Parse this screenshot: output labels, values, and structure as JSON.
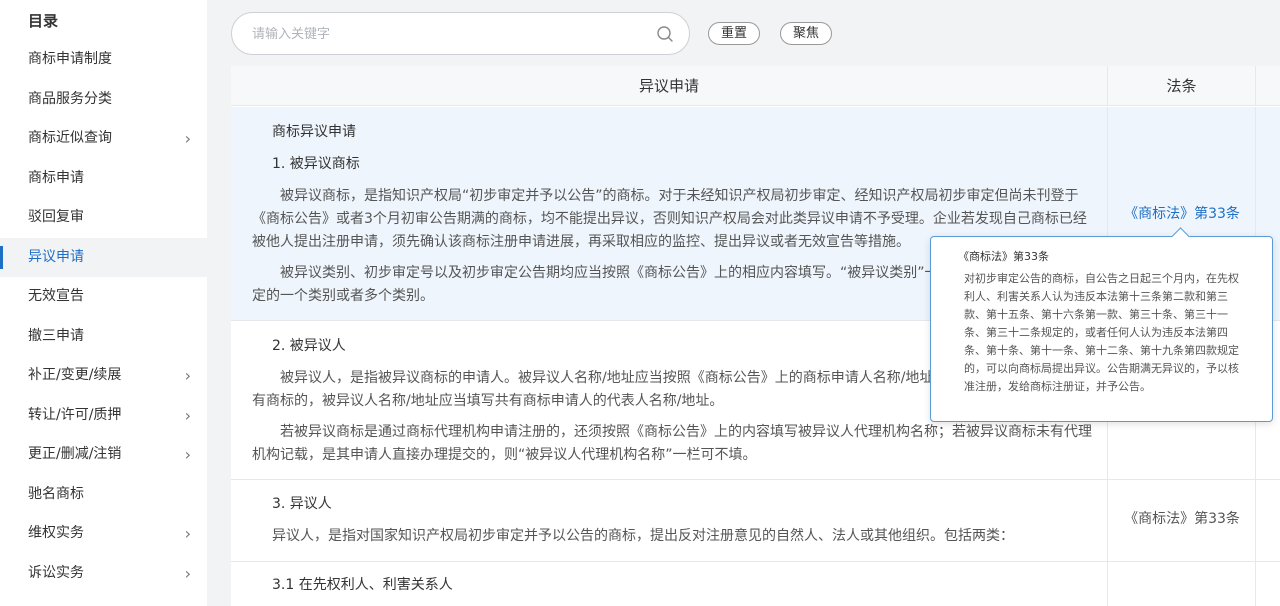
{
  "sidebar": {
    "title": "目录",
    "items": [
      {
        "label": "商标申请制度",
        "chevron": false,
        "active": false
      },
      {
        "label": "商品服务分类",
        "chevron": false,
        "active": false
      },
      {
        "label": "商标近似查询",
        "chevron": true,
        "active": false
      },
      {
        "label": "商标申请",
        "chevron": false,
        "active": false
      },
      {
        "label": "驳回复审",
        "chevron": false,
        "active": false
      },
      {
        "label": "异议申请",
        "chevron": false,
        "active": true
      },
      {
        "label": "无效宣告",
        "chevron": false,
        "active": false
      },
      {
        "label": "撤三申请",
        "chevron": false,
        "active": false
      },
      {
        "label": "补正/变更/续展",
        "chevron": true,
        "active": false
      },
      {
        "label": "转让/许可/质押",
        "chevron": true,
        "active": false
      },
      {
        "label": "更正/删减/注销",
        "chevron": true,
        "active": false
      },
      {
        "label": "驰名商标",
        "chevron": false,
        "active": false
      },
      {
        "label": "维权实务",
        "chevron": true,
        "active": false
      },
      {
        "label": "诉讼实务",
        "chevron": true,
        "active": false
      }
    ],
    "chevron_glyph": "›"
  },
  "search": {
    "placeholder": "请输入关键字",
    "value": "",
    "icon": "search-icon"
  },
  "buttons": {
    "reset": "重置",
    "focus": "聚焦"
  },
  "table": {
    "headers": {
      "main": "异议申请",
      "law": "法条"
    },
    "row1": {
      "section": "商标异议申请",
      "heading": "1. 被异议商标",
      "para1": "被异议商标，是指知识产权局“初步审定并予以公告”的商标。对于未经知识产权局初步审定、经知识产权局初步审定但尚未刊登于《商标公告》或者3个月初审公告期满的商标，均不能提出异议，否则知识产权局会对此类异议申请不予受理。企业若发现自己商标已经被他人提出注册申请，须先确认该商标注册申请进展，再采取相应的监控、提出异议或者无效宣告等措施。",
      "para2": "被异议类别、初步审定号以及初步审定公告期均应当按照《商标公告》上的相应内容填写。“被异议类别”一栏可以填写被异议商标指定的一个类别或者多个类别。",
      "law": "《商标法》第33条"
    },
    "row2": {
      "heading": "2. 被异议人",
      "para1": "被异议人，是指被异议商标的申请人。被异议人名称/地址应当按照《商标公告》上的商标申请人名称/地址填写，如被异议商标是共有商标的，被异议人名称/地址应当填写共有商标申请人的代表人名称/地址。",
      "para2": "若被异议商标是通过商标代理机构申请注册的，还须按照《商标公告》上的内容填写被异议人代理机构名称；若被异议商标未有代理机构记载，是其申请人直接办理提交的，则“被异议人代理机构名称”一栏可不填。"
    },
    "row3": {
      "heading": "3. 异议人",
      "para1": "异议人，是指对国家知识产权局初步审定并予以公告的商标，提出反对注册意见的自然人、法人或其他组织。包括两类：",
      "law": "《商标法》第33条"
    },
    "row4": {
      "heading": "3.1 在先权利人、利害关系人"
    }
  },
  "tooltip": {
    "title": "《商标法》第33条",
    "body": "对初步审定公告的商标，自公告之日起三个月内，在先权利人、利害关系人认为违反本法第十三条第二款和第三款、第十五条、第十六条第一款、第三十条、第三十一条、第三十二条规定的，或者任何人认为违反本法第四条、第十条、第十一条、第十二条、第十九条第四款规定的，可以向商标局提出异议。公告期满无异议的，予以核准注册，发给商标注册证，并予公告。"
  },
  "colors": {
    "accent": "#1f6fc6",
    "highlight_row": "#eef5fc",
    "tooltip_border": "#5b9bd5"
  }
}
